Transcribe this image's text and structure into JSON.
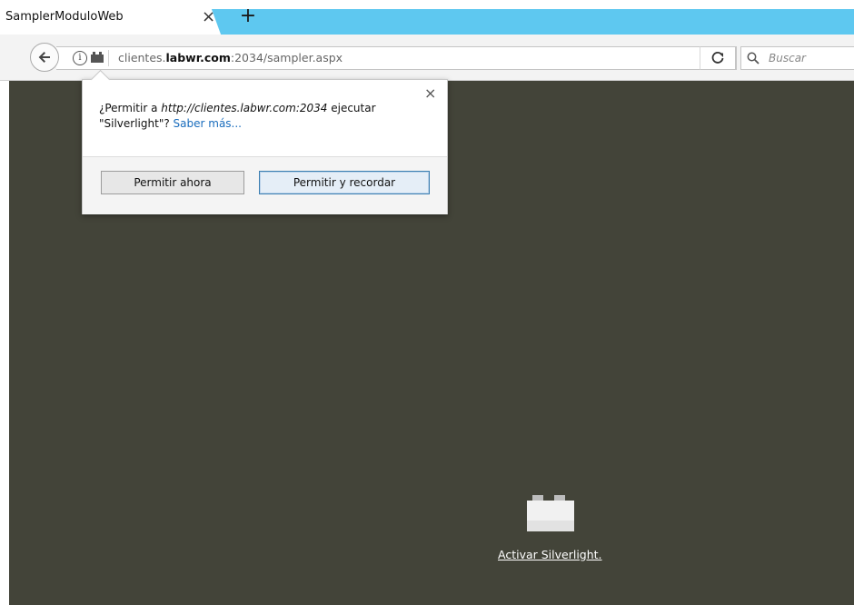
{
  "tab": {
    "title": "SamplerModuloWeb",
    "close_glyph": "×",
    "newtab_glyph": "+"
  },
  "navbar": {
    "url_host_pre": "clientes.",
    "url_host_domain": "labwr.com",
    "url_path": ":2034/sampler.aspx",
    "info_glyph": "i",
    "reload_glyph": "↻",
    "search_placeholder": "Buscar"
  },
  "panel": {
    "close_glyph": "×",
    "msg_prefix": "¿Permitir a ",
    "msg_host": "http://clientes.labwr.com:2034",
    "msg_middle": " ejecutar \"Silverlight\"? ",
    "msg_link": "Saber más...",
    "btn_now": "Permitir ahora",
    "btn_remember": "Permitir y recordar"
  },
  "content": {
    "activate_link": "Activar Silverlight."
  },
  "colors": {
    "tab_accent": "#5ec8f0",
    "content_bg": "#434439",
    "link_blue": "#1a6dbd"
  },
  "icons": {
    "back": "back-arrow-icon",
    "info": "info-icon",
    "plugin": "plugin-icon",
    "reload": "reload-icon",
    "search": "search-icon",
    "lego": "plugin-brick-icon"
  }
}
